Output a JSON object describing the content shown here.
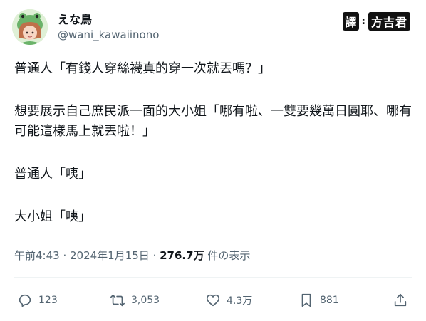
{
  "user": {
    "display_name": "えな鳥",
    "handle": "@wani_kawaiinono",
    "avatar_icon": "avatar-girl-frog-hood"
  },
  "credit": {
    "label": "譯",
    "separator": ":",
    "translator": "方吉君"
  },
  "tweet": {
    "lines": [
      "普通人「有錢人穿絲襪真的穿一次就丟嗎？」",
      "想要展示自己庶民派一面的大小姐「哪有啦、一雙要幾萬日圓耶、哪有可能這樣馬上就丟啦！」",
      "普通人「咦」",
      "大小姐「咦」"
    ]
  },
  "meta": {
    "time": "午前4:43",
    "sep1": " · ",
    "date": "2024年1月15日",
    "sep2": " · ",
    "views_count": "276.7万",
    "views_label": " 件の表示"
  },
  "actions": {
    "reply_count": "123",
    "retweet_count": "3,053",
    "like_count": "4.3万",
    "bookmark_count": "881"
  },
  "colors": {
    "text": "#0f1419",
    "secondary": "#536471",
    "divider": "#eff3f4"
  }
}
